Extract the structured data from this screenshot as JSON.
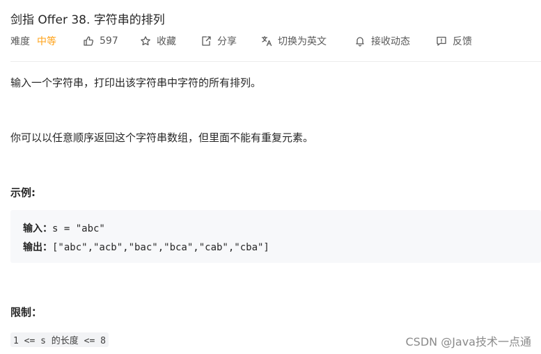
{
  "problem": {
    "title": "剑指 Offer 38. 字符串的排列"
  },
  "toolbar": {
    "difficulty_label": "难度",
    "difficulty_value": "中等",
    "likes": "597",
    "favorite": "收藏",
    "share": "分享",
    "translate": "切换为英文",
    "subscribe": "接收动态",
    "feedback": "反馈",
    "colors": {
      "difficulty_medium": "#ffa116",
      "text_secondary": "#595959"
    },
    "icons": [
      "thumbs-up-icon",
      "star-icon",
      "share-icon",
      "translate-icon",
      "bell-icon",
      "feedback-icon"
    ]
  },
  "content": {
    "paragraph1": "输入一个字符串，打印出该字符串中字符的所有排列。",
    "paragraph2": "你可以以任意顺序返回这个字符串数组，但里面不能有重复元素。",
    "example_heading": "示例:",
    "example": {
      "input_label": "输入：",
      "input_value": "s = \"abc\"",
      "output_label": "输出：",
      "output_value": "[\"abc\",\"acb\",\"bac\",\"bca\",\"cab\",\"cba\"]"
    },
    "constraints_heading": "限制：",
    "constraint": "1 <= s 的长度 <= 8"
  },
  "watermark": "CSDN @Java技术一点通"
}
